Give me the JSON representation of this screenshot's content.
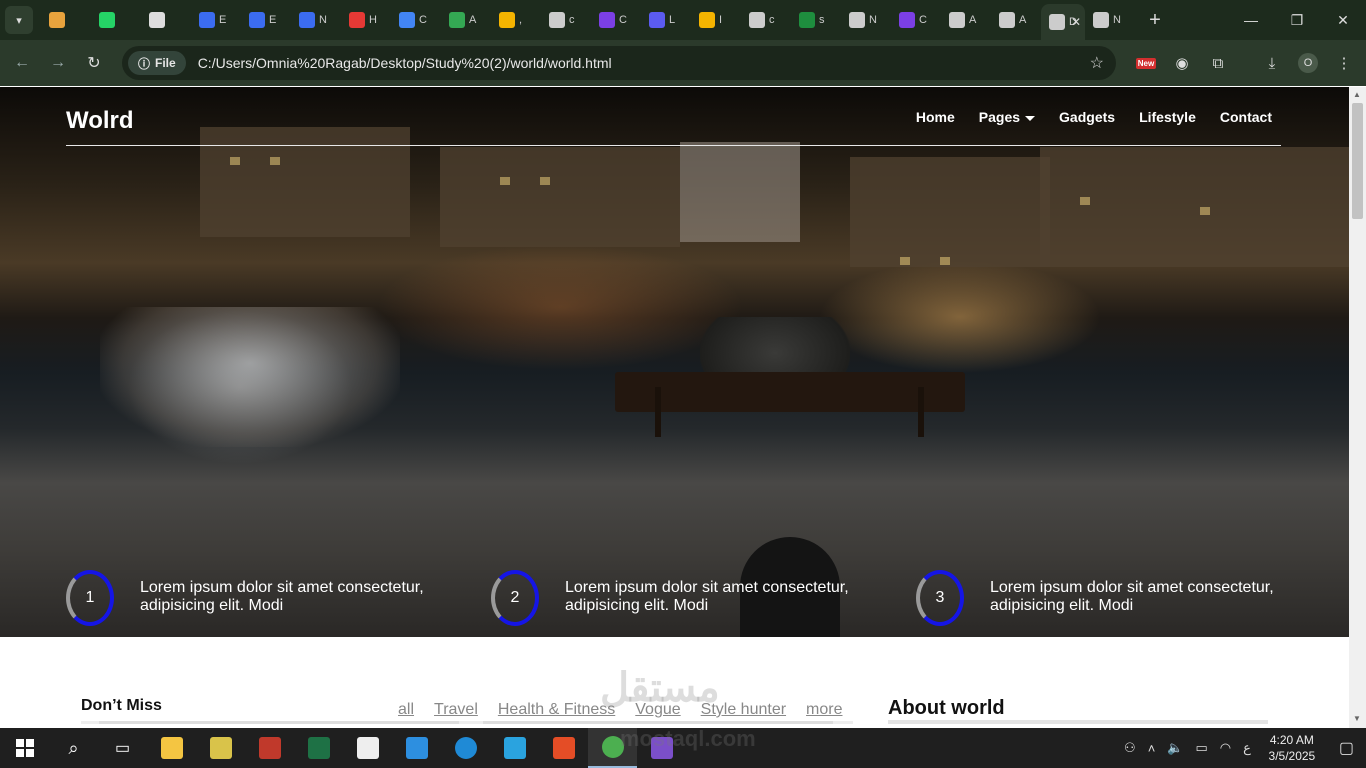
{
  "browser": {
    "tabs": [
      {
        "label": "",
        "color": "#e8a33d"
      },
      {
        "label": "",
        "color": "#25d366"
      },
      {
        "label": "",
        "color": "#dddddd"
      },
      {
        "label": "E",
        "color": "#3b6cf0"
      },
      {
        "label": "E",
        "color": "#3b6cf0"
      },
      {
        "label": "N",
        "color": "#3b6cf0"
      },
      {
        "label": "H",
        "color": "#e53935"
      },
      {
        "label": "C",
        "color": "#4285f4"
      },
      {
        "label": "A",
        "color": "#34a853"
      },
      {
        "label": ",",
        "color": "#f4b400"
      },
      {
        "label": "c",
        "color": "#cccccc"
      },
      {
        "label": "C",
        "color": "#7b3fe4"
      },
      {
        "label": "L",
        "color": "#5b5bf0"
      },
      {
        "label": "I",
        "color": "#f4b400"
      },
      {
        "label": "c",
        "color": "#cccccc"
      },
      {
        "label": "s",
        "color": "#1e8e3e"
      },
      {
        "label": "N",
        "color": "#cccccc"
      },
      {
        "label": "C",
        "color": "#7b3fe4"
      },
      {
        "label": "A",
        "color": "#cccccc"
      },
      {
        "label": "A",
        "color": "#cccccc"
      },
      {
        "label": "D",
        "color": "#cccccc",
        "active": true
      },
      {
        "label": "N",
        "color": "#cccccc"
      }
    ],
    "file_chip": "File",
    "url": "C:/Users/Omnia%20Ragab/Desktop/Study%20(2)/world/world.html",
    "profile_initial": "O",
    "new_badge": "New"
  },
  "site": {
    "logo": "Wolrd",
    "menu": [
      "Home",
      "Pages",
      "Gadgets",
      "Lifestyle",
      "Contact"
    ],
    "features": [
      {
        "num": "1",
        "text": "Lorem ipsum dolor sit amet consectetur, adipisicing elit. Modi"
      },
      {
        "num": "2",
        "text": "Lorem ipsum dolor sit amet consectetur, adipisicing elit. Modi"
      },
      {
        "num": "3",
        "text": "Lorem ipsum dolor sit amet consectetur, adipisicing elit. Modi"
      }
    ],
    "dont_miss": "Don’t Miss",
    "filters": [
      "all",
      "Travel",
      "Health & Fitness",
      "Vogue",
      "Style hunter",
      "more"
    ],
    "about": "About world"
  },
  "watermark": {
    "top": "مستقل",
    "bottom": "mostaql.com"
  },
  "taskbar": {
    "apps": [
      {
        "name": "file-explorer",
        "color": "#f4c542"
      },
      {
        "name": "sql-tool",
        "color": "#d9c34a"
      },
      {
        "name": "access",
        "color": "#c0392b"
      },
      {
        "name": "excel",
        "color": "#1e7145"
      },
      {
        "name": "notion",
        "color": "#eeeeee"
      },
      {
        "name": "vscode",
        "color": "#2d8fe0"
      },
      {
        "name": "edge",
        "color": "#1f8ad6"
      },
      {
        "name": "telegram",
        "color": "#2aa3df"
      },
      {
        "name": "store",
        "color": "#e44d26"
      },
      {
        "name": "chrome",
        "color": "#4caf50",
        "active": true
      },
      {
        "name": "visual-studio",
        "color": "#7b4fc9"
      }
    ],
    "lang": "ع",
    "time": "4:20 AM",
    "date": "3/5/2025"
  }
}
